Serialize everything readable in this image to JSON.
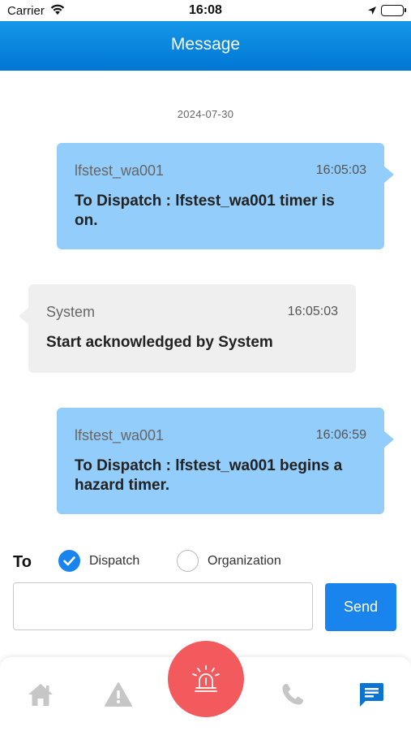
{
  "status_bar": {
    "carrier": "Carrier",
    "time": "16:08"
  },
  "header": {
    "title": "Message"
  },
  "date_separator": "2024-07-30",
  "messages": [
    {
      "direction": "out",
      "sender": "lfstest_wa001",
      "time": "16:05:03",
      "text": "To Dispatch : lfstest_wa001 timer is on."
    },
    {
      "direction": "in",
      "sender": "System",
      "time": "16:05:03",
      "text": "Start acknowledged by System"
    },
    {
      "direction": "out",
      "sender": "lfstest_wa001",
      "time": "16:06:59",
      "text": "To Dispatch : lfstest_wa001 begins a hazard timer."
    }
  ],
  "compose": {
    "to_label": "To",
    "recipients": [
      {
        "label": "Dispatch",
        "selected": true
      },
      {
        "label": "Organization",
        "selected": false
      }
    ],
    "input_value": "",
    "input_placeholder": "",
    "send_label": "Send"
  },
  "tab_bar": {
    "tabs": [
      {
        "icon": "home-icon",
        "active": false
      },
      {
        "icon": "warning-icon",
        "active": false
      },
      {
        "icon": "alarm-icon",
        "active": false
      },
      {
        "icon": "phone-icon",
        "active": false
      },
      {
        "icon": "message-icon",
        "active": true
      }
    ]
  },
  "colors": {
    "header": "#0a86de",
    "outgoing_bubble": "#93cdfb",
    "incoming_bubble": "#efefef",
    "accent": "#1a84ee",
    "alarm": "#f25a5e",
    "inactive_icon": "#c6c6c6"
  }
}
